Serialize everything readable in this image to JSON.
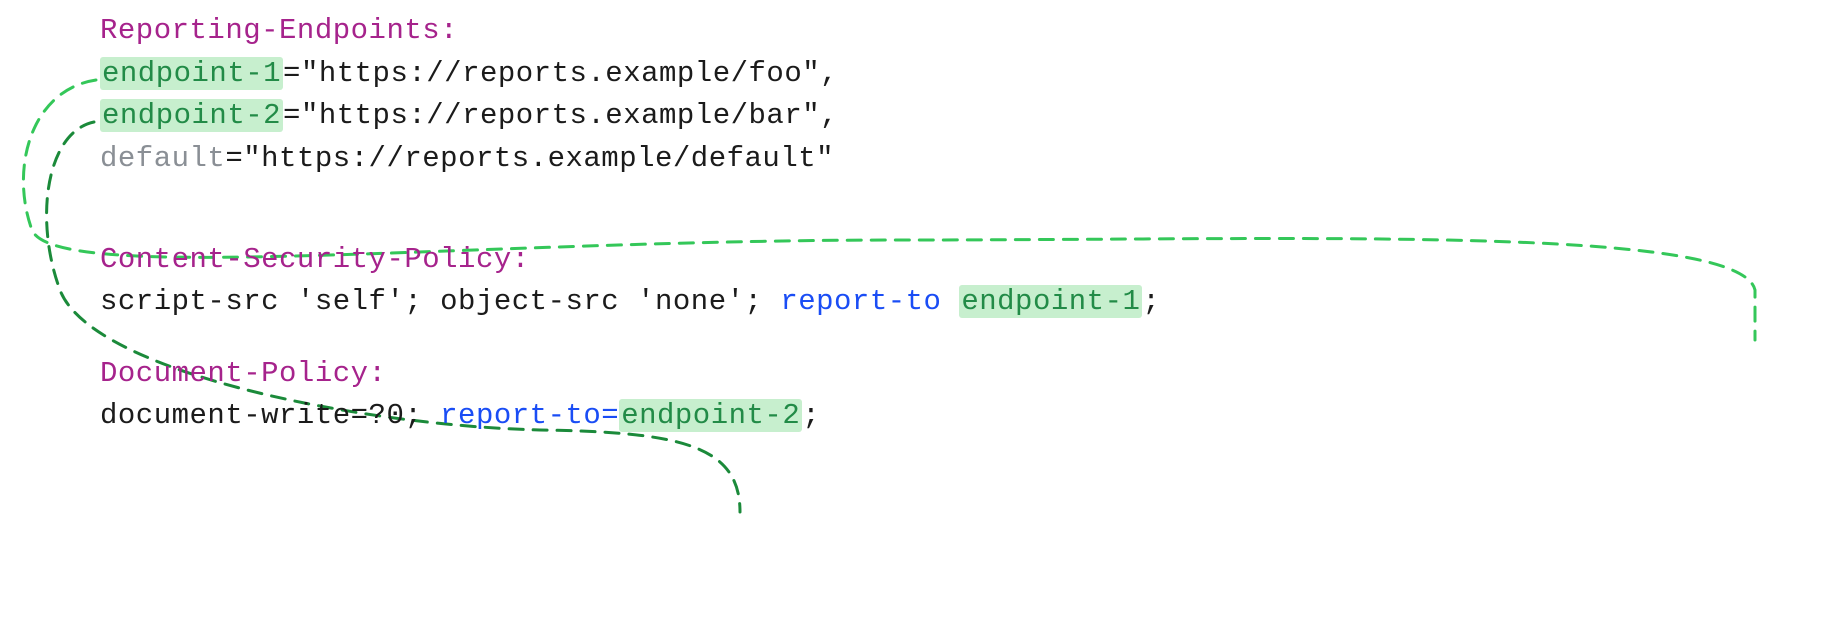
{
  "reporting_endpoints": {
    "header": "Reporting-Endpoints:",
    "lines": [
      {
        "name": "endpoint-1",
        "sep": "=",
        "url": "\"https://reports.example/foo\"",
        "trail": ",",
        "highlight": true
      },
      {
        "name": "endpoint-2",
        "sep": "=",
        "url": "\"https://reports.example/bar\"",
        "trail": ",",
        "highlight": true
      },
      {
        "name": "default",
        "sep": "=",
        "url": "\"https://reports.example/default\"",
        "trail": "",
        "highlight": false
      }
    ]
  },
  "csp": {
    "header": "Content-Security-Policy:",
    "body_prefix": "script-src 'self'; object-src 'none'; ",
    "report_to": "report-to ",
    "target": "endpoint-1",
    "trail": ";"
  },
  "docpolicy": {
    "header": "Document-Policy:",
    "body_prefix": "document-write=?0; ",
    "report_to": "report-to=",
    "target": "endpoint-2",
    "trail": ";"
  },
  "arrows": {
    "stroke_light": "#34c759",
    "stroke_dark": "#1b8a3a"
  }
}
